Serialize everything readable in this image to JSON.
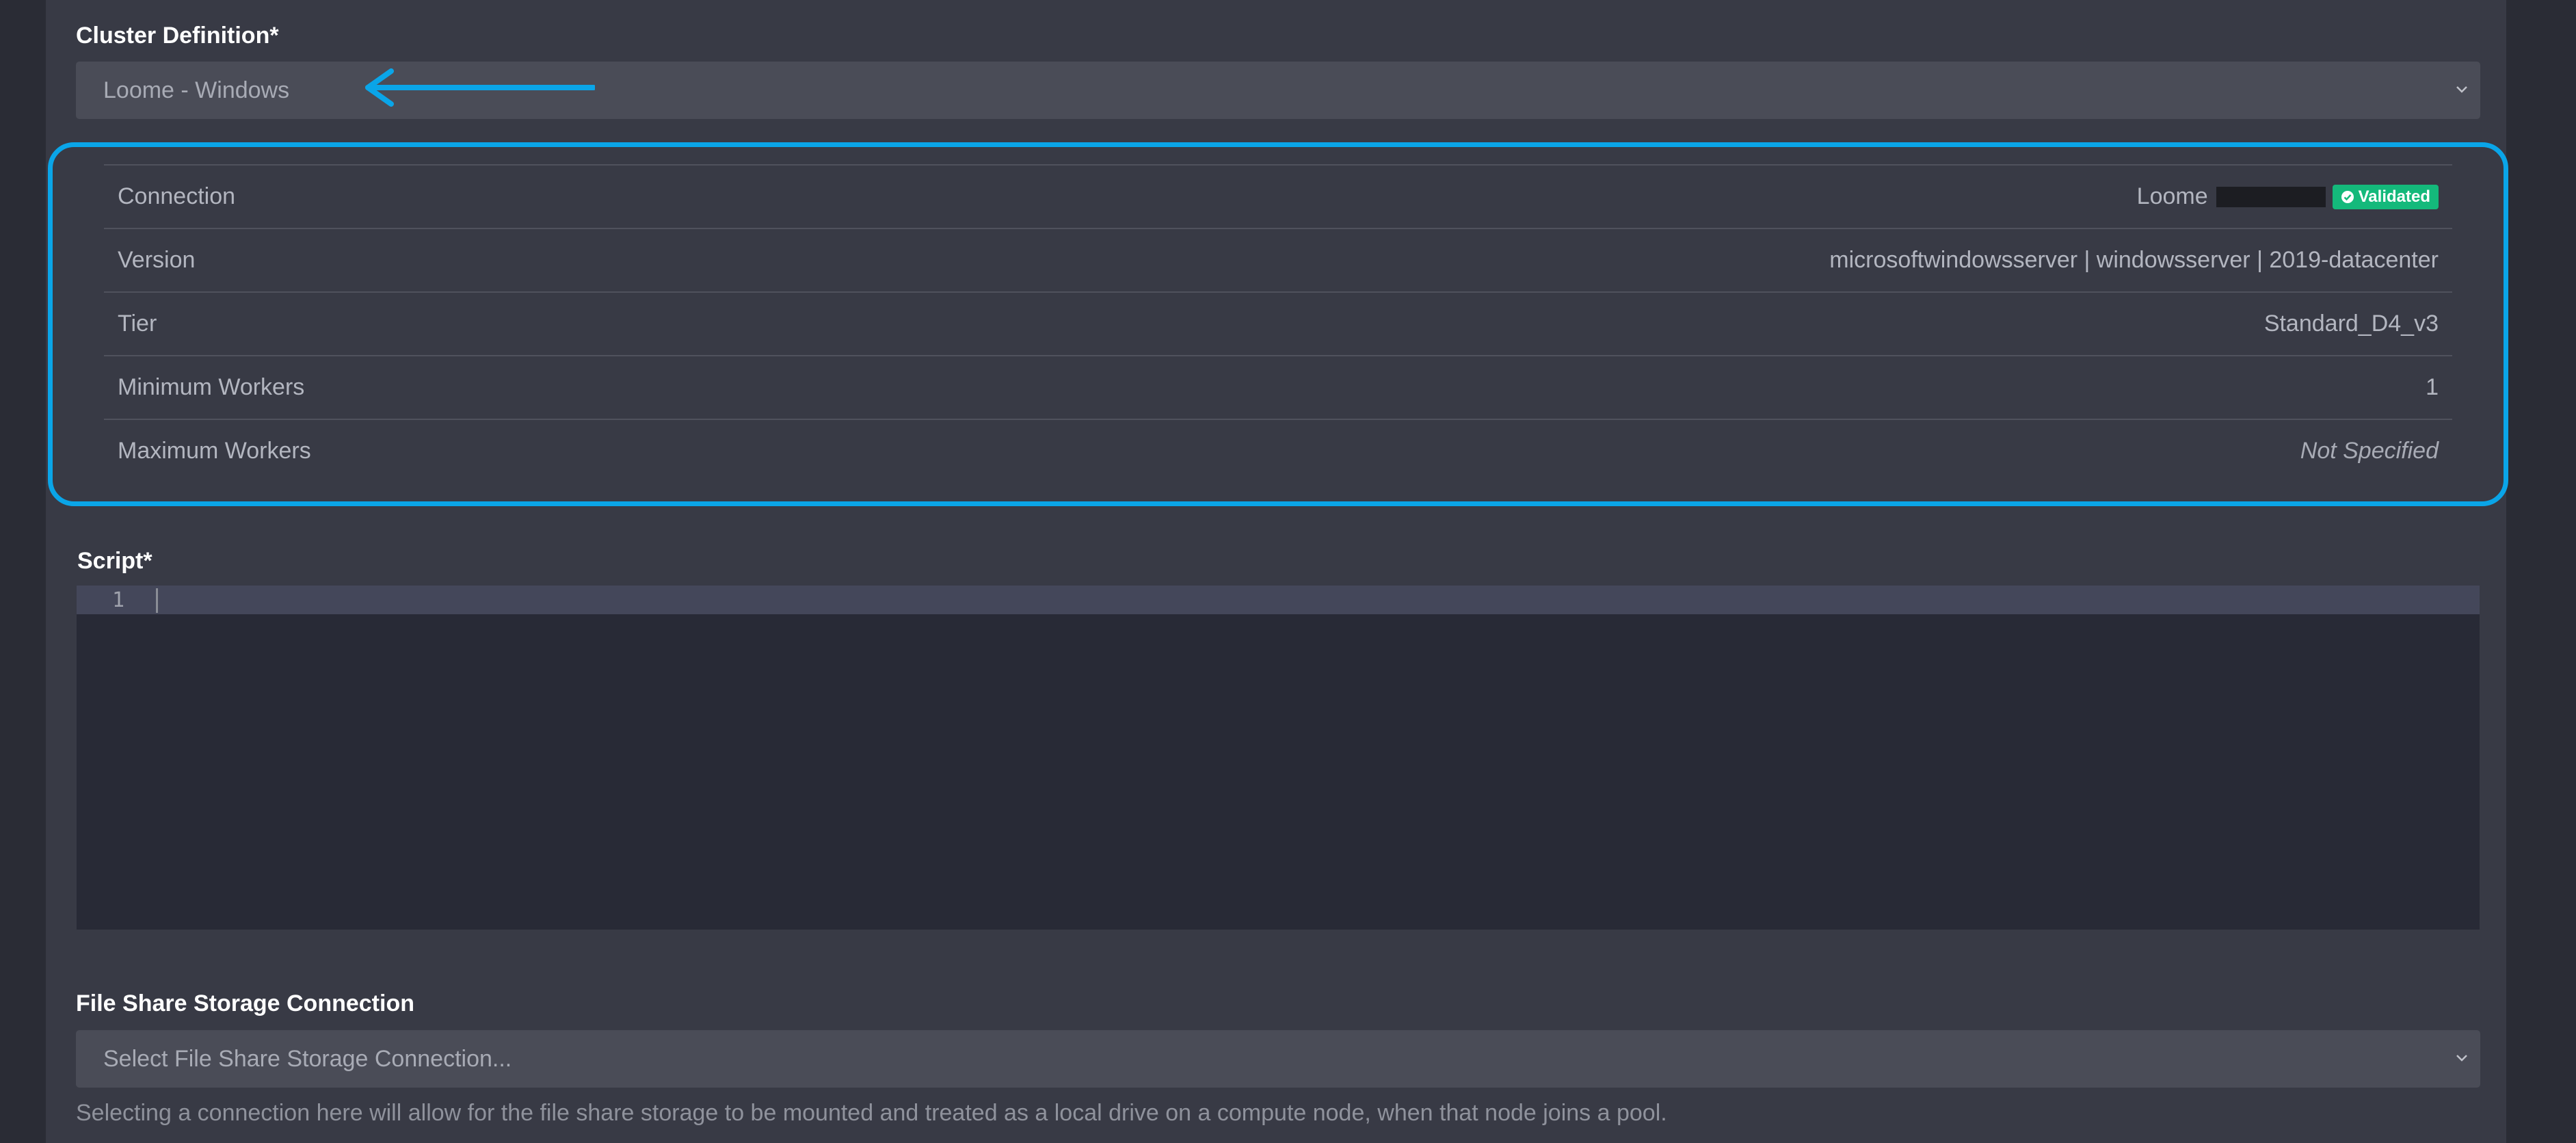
{
  "cluster_definition": {
    "label": "Cluster Definition*",
    "selected": "Loome  - Windows"
  },
  "annotation_colors": {
    "highlight": "#0aa5e8",
    "validated_badge": "#14b97b"
  },
  "details": {
    "rows": [
      {
        "key": "Connection",
        "value": "Loome",
        "redacted": true,
        "badge": "Validated"
      },
      {
        "key": "Version",
        "value": "microsoftwindowsserver | windowsserver | 2019-datacenter"
      },
      {
        "key": "Tier",
        "value": "Standard_D4_v3"
      },
      {
        "key": "Minimum Workers",
        "value": "1"
      },
      {
        "key": "Maximum Workers",
        "value": "Not Specified"
      }
    ]
  },
  "script": {
    "label": "Script*",
    "line_numbers": [
      "1"
    ]
  },
  "file_share": {
    "label": "File Share Storage Connection",
    "placeholder": "Select File Share Storage Connection...",
    "help": "Selecting a connection here will allow for the file share storage to be mounted and treated as a local drive on a compute node, when that node joins a pool."
  }
}
